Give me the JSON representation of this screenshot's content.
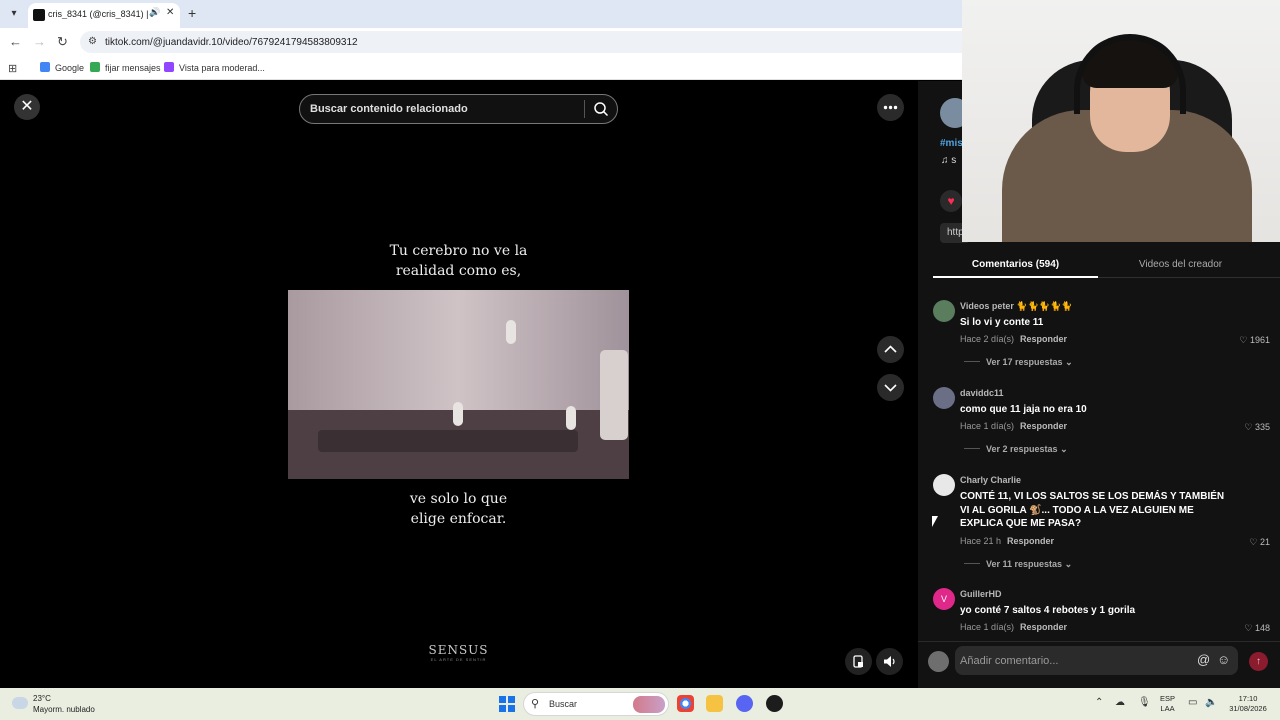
{
  "browser": {
    "tab_title": "cris_8341 (@cris_8341) | Tik",
    "url": "tiktok.com/@juandavidr.10/video/7679241794583809312",
    "bookmarks": [
      {
        "label": "Google",
        "color": "#4285f4"
      },
      {
        "label": "fijar mensajes",
        "color": "#34a853"
      },
      {
        "label": "Vista para moderad...",
        "color": "#9146ff"
      }
    ]
  },
  "video": {
    "search_placeholder": "Buscar contenido relacionado",
    "caption_top_1": "Tu cerebro no ve la",
    "caption_top_2": "realidad como es,",
    "caption_bottom_1": "ve solo lo que",
    "caption_bottom_2": "elige enfocar.",
    "brand": "SENSUS",
    "brand_sub": "EL ARTE DE SENTIR"
  },
  "panel": {
    "peek_tag": "#mis",
    "peek_note": "♫ s",
    "peek_link": "http",
    "tabs": {
      "comments": "Comentarios (594)",
      "creator_videos": "Videos del creador"
    },
    "comments": [
      {
        "user": "Videos peter 🐈🐈🐈🐈🐈",
        "text": "Si lo vi y conte 11",
        "time": "Hace 2 día(s)",
        "reply": "Responder",
        "likes": "1961",
        "more": "Ver 17 respuestas",
        "avatar_color": "#5a7d5e"
      },
      {
        "user": "daviddc11",
        "text": "como que 11 jaja no era 10",
        "time": "Hace 1 día(s)",
        "reply": "Responder",
        "likes": "335",
        "more": "Ver 2 respuestas",
        "avatar_color": "#6b6f85"
      },
      {
        "user": "Charly Charlie",
        "text": "CONTÉ 11, VI LOS SALTOS SE LOS DEMÁS Y TAMBIÉN VI AL GORILA 🐒... TODO A LA VEZ ALGUIEN ME EXPLICA QUE ME PASA?",
        "time": "Hace 21 h",
        "reply": "Responder",
        "likes": "21",
        "more": "Ver 11 respuestas",
        "avatar_color": "#e8e8e8"
      },
      {
        "user": "GuillerHD",
        "text": "yo conté 7 saltos 4 rebotes y 1 gorila",
        "time": "Hace 1 día(s)",
        "reply": "Responder",
        "likes": "148",
        "avatar_letter": "V",
        "avatar_color": "#e0288a"
      }
    ],
    "add_comment_placeholder": "Añadir comentario..."
  },
  "taskbar": {
    "temperature": "23°C",
    "weather": "Mayorm. nublado",
    "search_label": "Buscar",
    "lang_1": "ESP",
    "lang_2": "LAA",
    "time": "17:10",
    "date": "31/08/2026"
  },
  "colors": {
    "accent_like": "#fe2c55",
    "link_blue": "#4fa3e0"
  }
}
